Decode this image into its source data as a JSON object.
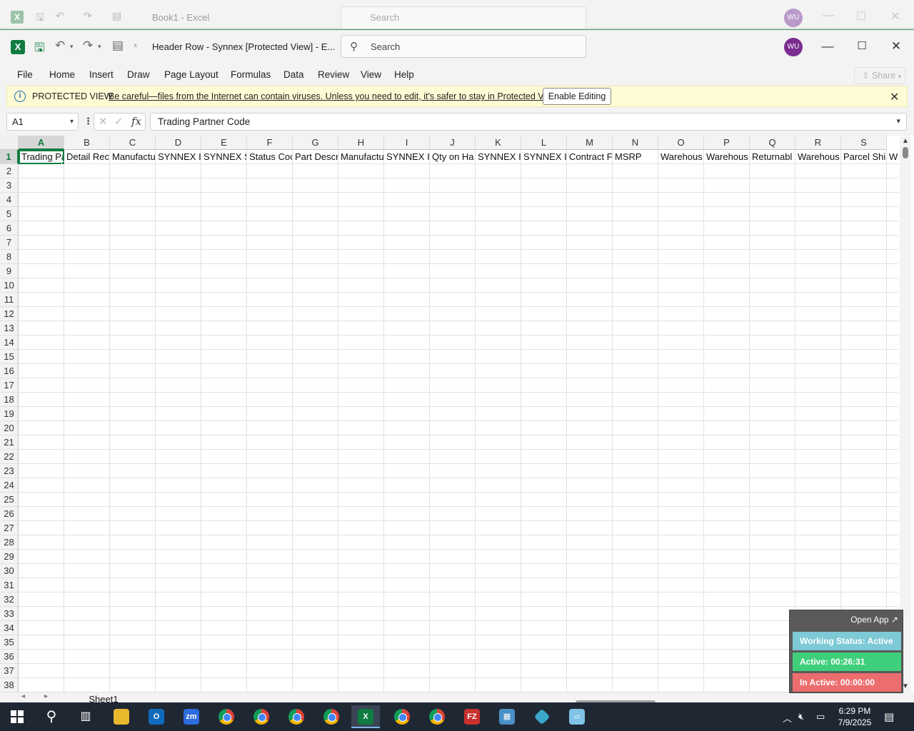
{
  "background_window": {
    "title": "Book1  -  Excel",
    "search_placeholder": "Search",
    "avatar": "WU"
  },
  "titlebar": {
    "doc_title": "Header Row - Synnex  [Protected View]  -  E...",
    "search_placeholder": "Search",
    "avatar": "WU",
    "minimize": "—",
    "maximize": "☐",
    "close": "✕"
  },
  "menu": {
    "items": [
      "File",
      "Home",
      "Insert",
      "Draw",
      "Page Layout",
      "Formulas",
      "Data",
      "Review",
      "View",
      "Help"
    ],
    "share": "Share"
  },
  "protected_view": {
    "title": "PROTECTED VIEW",
    "message": "Be careful—files from the Internet can contain viruses. Unless you need to edit, it's safer to stay in Protected View.",
    "button": "Enable Editing"
  },
  "formula_bar": {
    "name_box": "A1",
    "fx": "fx",
    "value": "Trading Partner Code"
  },
  "sheet": {
    "columns": [
      "A",
      "B",
      "C",
      "D",
      "E",
      "F",
      "G",
      "H",
      "I",
      "J",
      "K",
      "L",
      "M",
      "N",
      "O",
      "P",
      "Q",
      "R",
      "S"
    ],
    "row_count": 38,
    "row1": [
      "Trading Pa",
      "Detail Rec",
      "Manufactu",
      "SYNNEX Ir",
      "SYNNEX SI",
      "Status Coc",
      "Part Descr",
      "Manufactu",
      "SYNNEX Ir",
      "Qty on Ha",
      "SYNNEX Ir",
      "SYNNEX Ir",
      "Contract F",
      "MSRP",
      "Warehous",
      "Warehous",
      "Returnabl",
      "Warehous",
      "Parcel Shi",
      "W"
    ],
    "active_cell": "A1",
    "tab": "Sheet1"
  },
  "tracker": {
    "open_app": "Open App ↗",
    "status": "Working Status: Active",
    "active": "Active: 00:26:31",
    "inactive": "In Active: 00:00:00",
    "colors": {
      "status": "#7ec9d6",
      "active": "#3fcf7a",
      "inactive": "#ec6d6d"
    }
  },
  "taskbar": {
    "time": "6:29 PM",
    "date": "7/9/2025",
    "icons": [
      "windows-start",
      "search",
      "task-view",
      "file-explorer",
      "outlook",
      "zoom",
      "chrome-w",
      "chrome",
      "chrome-2",
      "chrome-3",
      "excel",
      "chrome-4",
      "chrome-5",
      "filezilla",
      "calculator",
      "app-blue",
      "notes"
    ]
  }
}
